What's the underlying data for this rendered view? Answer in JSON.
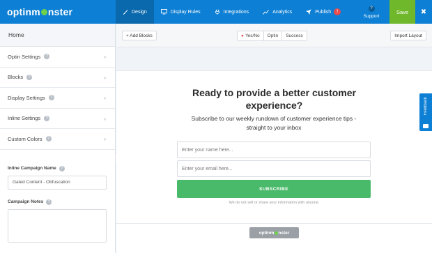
{
  "brand": {
    "logo_prefix": "optinm",
    "logo_suffix": "nster",
    "accent": "#0d7fd4",
    "save_color": "#6fb82b"
  },
  "nav": {
    "items": [
      {
        "label": "Design",
        "icon": "paintbrush-icon",
        "active": true
      },
      {
        "label": "Display Rules",
        "icon": "monitor-icon",
        "active": false
      },
      {
        "label": "Integrations",
        "icon": "plug-icon",
        "active": false
      },
      {
        "label": "Analytics",
        "icon": "chart-icon",
        "active": false
      },
      {
        "label": "Publish",
        "icon": "rocket-icon",
        "active": false,
        "badge": "!"
      }
    ],
    "support_label": "Support",
    "support_icon_text": "?",
    "save_label": "Save",
    "close_glyph": "✖"
  },
  "sidebar": {
    "home": "Home",
    "sections": [
      {
        "label": "Optin Settings"
      },
      {
        "label": "Blocks"
      },
      {
        "label": "Display Settings"
      },
      {
        "label": "Inline Settings"
      },
      {
        "label": "Custom Colors"
      }
    ],
    "campaign_name_label": "Inline Campaign Name",
    "campaign_name_value": "Gated Content - Obfuscation",
    "campaign_notes_label": "Campaign Notes",
    "campaign_notes_value": ""
  },
  "toolbar": {
    "add_blocks": "+ Add Blocks",
    "views": [
      {
        "label": "Yes/No",
        "prefix": "●"
      },
      {
        "label": "Optin"
      },
      {
        "label": "Success"
      }
    ],
    "import_layout": "Import Layout"
  },
  "optin": {
    "headline_line1": "Ready to provide a better customer",
    "headline_line2": "experience?",
    "subhead_line1": "Subscribe to our weekly rundown of customer experience tips -",
    "subhead_line2": "straight to your inbox",
    "name_placeholder": "Enter your name here...",
    "email_placeholder": "Enter your email here...",
    "subscribe_label": "SUBSCRIBE",
    "privacy_note": "We do not sell or share your information with anyone.",
    "powered_prefix": "optinm",
    "powered_suffix": "nster",
    "button_color": "#49b96a"
  },
  "feedback": {
    "label": "Feedback"
  }
}
